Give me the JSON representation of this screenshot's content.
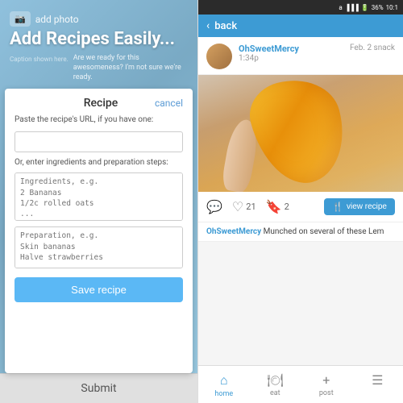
{
  "left": {
    "header": {
      "addPhotoLabel": "add photo",
      "bigTitle": "Add Recipes Easily...",
      "subText": "Are we ready for this awesomeness? I'm not sure we're ready.",
      "captionPlaceholder": "Caption shown here."
    },
    "dialog": {
      "title": "Recipe",
      "cancelLabel": "cancel",
      "urlLabel": "Paste the recipe's URL, if you have one:",
      "orLabel": "Or, enter ingredients and preparation steps:",
      "ingredientsPlaceholder": "Ingredients, e.g.\n2 Bananas\n1/2c rolled oats\n...",
      "preparationPlaceholder": "Preparation, e.g.\nSkin bananas\nHalve strawberries\n...",
      "saveBtnLabel": "Save recipe"
    },
    "footer": {
      "submitLabel": "Submit"
    }
  },
  "right": {
    "statusBar": {
      "signal": "36%",
      "time": "10:1"
    },
    "nav": {
      "backLabel": "back"
    },
    "post": {
      "username": "OhSweetMercy",
      "date": "Feb. 2 snack",
      "time": "1:34p",
      "description": "Munched on several of these Lem"
    },
    "actions": {
      "commentCount": "",
      "likeCount": "21",
      "bookmarkCount": "2",
      "viewRecipeLabel": "view recipe"
    },
    "bottomNav": [
      {
        "icon": "🏠",
        "label": "home",
        "active": true
      },
      {
        "icon": "🍽",
        "label": "eat",
        "active": false
      },
      {
        "icon": "+",
        "label": "post",
        "active": false
      },
      {
        "icon": "☰",
        "label": "",
        "active": false
      }
    ]
  }
}
